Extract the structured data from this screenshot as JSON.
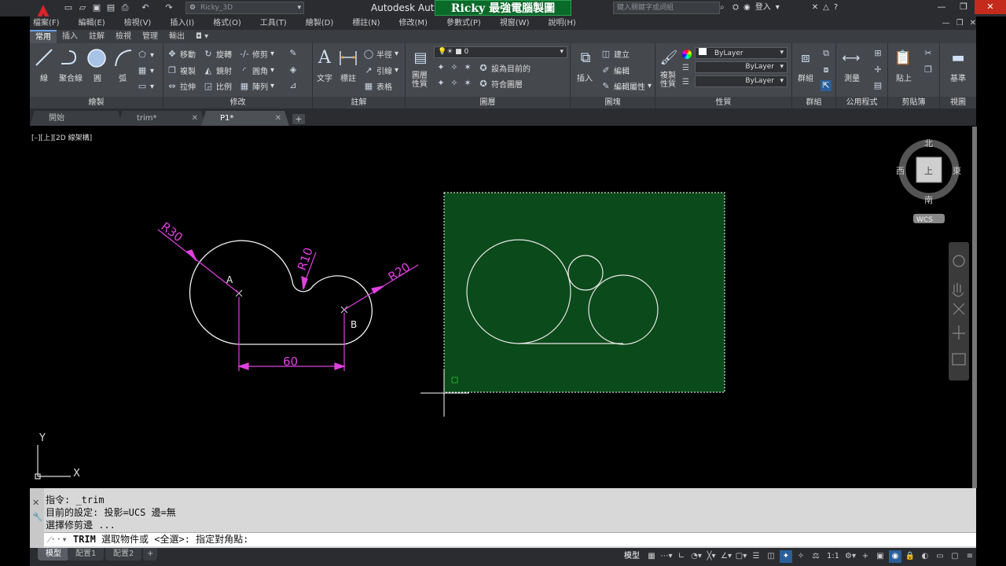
{
  "titlebar": {
    "workspace": "Ricky_3D",
    "app_title": "Autodesk Aut",
    "overlay_title": "Ricky 最強電腦製圖",
    "search_placeholder": "鍵入關鍵字或詞組",
    "login_label": "登入"
  },
  "menu": [
    "檔案(F)",
    "編輯(E)",
    "檢視(V)",
    "插入(I)",
    "格式(O)",
    "工具(T)",
    "繪製(D)",
    "標註(N)",
    "修改(M)",
    "參數式(P)",
    "視窗(W)",
    "說明(H)"
  ],
  "ribbon_tabs": [
    "常用",
    "插入",
    "註解",
    "檢視",
    "管理",
    "輸出"
  ],
  "ribbon": {
    "draw": {
      "title": "繪製",
      "line": "線",
      "polyline": "聚合線",
      "circle": "圓",
      "arc": "弧"
    },
    "modify": {
      "title": "修改",
      "move": "移動",
      "rotate": "旋轉",
      "trim": "修剪",
      "copy": "複製",
      "mirror": "鏡射",
      "fillet": "圓角",
      "stretch": "拉伸",
      "scale": "比例",
      "array": "陣列"
    },
    "annotation": {
      "title": "註解",
      "text": "文字",
      "dimension": "標註",
      "radius": "半徑",
      "leader": "引線",
      "table": "表格"
    },
    "layers": {
      "title": "圖層",
      "properties": "圖層\n性質",
      "current_layer": "0",
      "set_current": "設為目前的",
      "match": "符合圖層"
    },
    "block": {
      "title": "圖塊",
      "insert": "插入",
      "create": "建立",
      "edit": "編輯",
      "edit_attr": "編輯屬性"
    },
    "properties": {
      "title": "性質",
      "match": "複製\n性質",
      "color": "ByLayer",
      "linetype": "ByLayer",
      "lineweight": "ByLayer"
    },
    "groups": {
      "title": "群組",
      "group": "群組"
    },
    "utilities": {
      "title": "公用程式",
      "measure": "測量"
    },
    "clipboard": {
      "title": "剪貼簿",
      "paste": "貼上"
    },
    "view": {
      "title": "視圖",
      "base": "基準"
    }
  },
  "file_tabs": [
    {
      "label": "開始"
    },
    {
      "label": "trim*"
    },
    {
      "label": "P1*"
    }
  ],
  "viewport_label": "[–][上][2D 線架構]",
  "viewcube": {
    "north": "北",
    "south": "南",
    "east": "東",
    "west": "西",
    "top": "上",
    "wcs": "WCS"
  },
  "drawing": {
    "r30": "R30",
    "r10": "R10",
    "r20": "R20",
    "dim": "60",
    "point_a": "A",
    "point_b": "B",
    "ucs_x": "X",
    "ucs_y": "Y"
  },
  "command": {
    "line1": "指令: _trim",
    "line2": "目前的設定: 投影=UCS  邊=無",
    "line3": "選擇修剪邊 ...",
    "input_cmd": "TRIM",
    "input_prompt": "選取物件或 <全選>: 指定對角點:"
  },
  "layout_tabs": [
    "模型",
    "配置1",
    "配置2"
  ],
  "status": {
    "model": "模型",
    "scale": "1:1"
  }
}
